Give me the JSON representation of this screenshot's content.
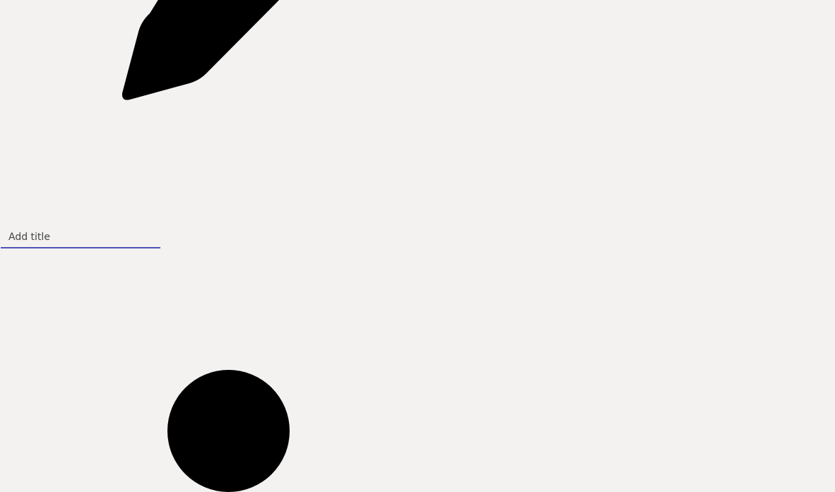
{
  "title_input": {
    "value": "",
    "placeholder": "Add title"
  },
  "icons": {
    "top": "pencil-icon",
    "bottom": "circle-icon"
  },
  "colors": {
    "background": "#f3f2f1",
    "accent_underline": "#4f52b2",
    "icon_fill": "#000000"
  }
}
